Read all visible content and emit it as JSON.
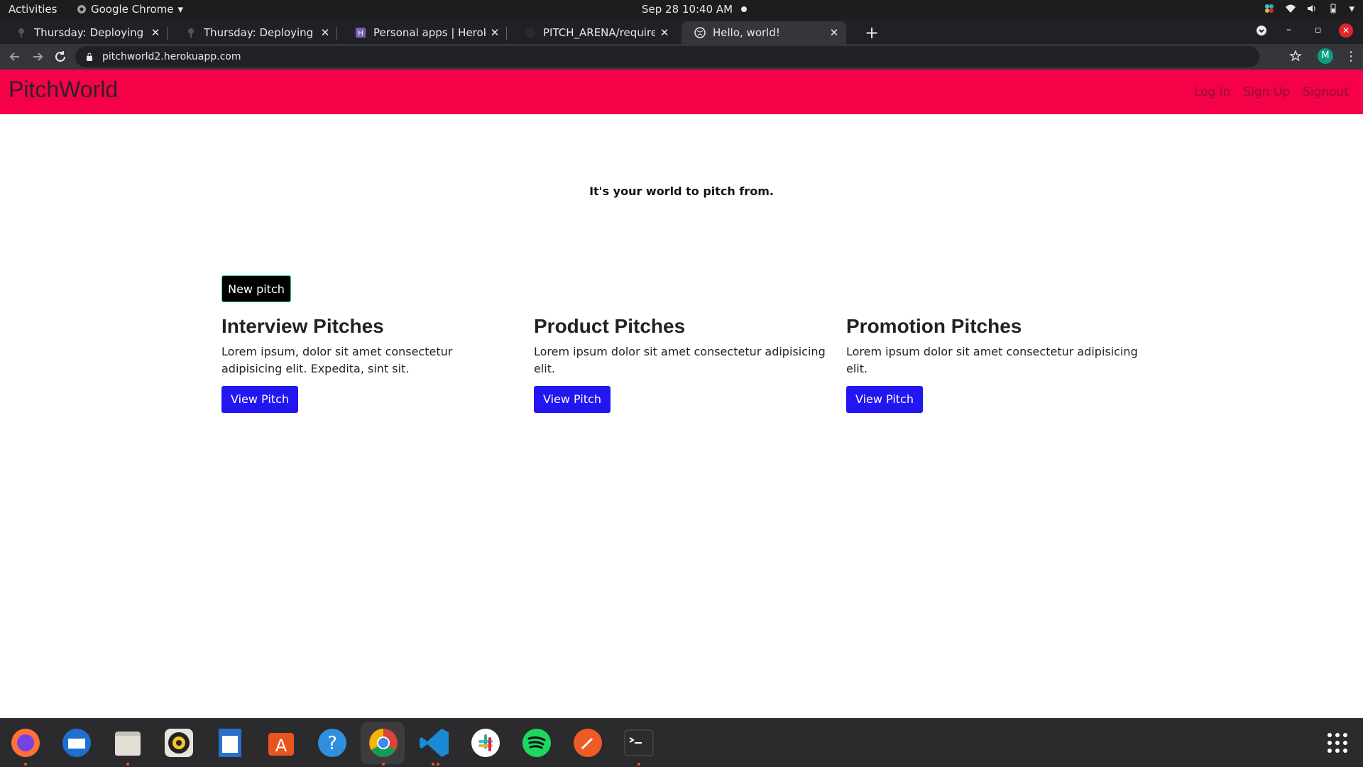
{
  "system": {
    "activities": "Activities",
    "app_name": "Google Chrome",
    "clock": "Sep 28  10:40 AM"
  },
  "tabs": [
    {
      "title": "Thursday: Deploying to H",
      "active": false
    },
    {
      "title": "Thursday: Deploying to H",
      "active": false
    },
    {
      "title": "Personal apps | Heroku",
      "active": false
    },
    {
      "title": "PITCH_ARENA/requireme",
      "active": false
    },
    {
      "title": "Hello, world!",
      "active": true
    }
  ],
  "browser": {
    "url": "pitchworld2.herokuapp.com",
    "profile_initial": "M"
  },
  "site": {
    "brand": "PitchWorld",
    "nav": {
      "login": "Log in",
      "signup": "Sign Up",
      "signout": "Signout"
    },
    "tagline": "It's your world to pitch from.",
    "new_pitch": "New pitch",
    "categories": [
      {
        "title": "Interview Pitches",
        "text": "Lorem ipsum, dolor sit amet consectetur adipisicing elit. Expedita, sint sit.",
        "button": "View Pitch"
      },
      {
        "title": "Product Pitches",
        "text": "Lorem ipsum dolor sit amet consectetur adipisicing elit.",
        "button": "View Pitch"
      },
      {
        "title": "Promotion Pitches",
        "text": "Lorem ipsum dolor sit amet consectetur adipisicing elit.",
        "button": "View Pitch"
      }
    ]
  },
  "colors": {
    "navbar": "#f40148",
    "button_primary": "#2316f0",
    "button_dark": "#000000"
  },
  "dock_icons": [
    "firefox-icon",
    "thunderbird-icon",
    "files-icon",
    "rhythmbox-icon",
    "writer-icon",
    "software-icon",
    "help-icon",
    "chrome-icon",
    "vscode-icon",
    "slack-icon",
    "spotify-icon",
    "postman-icon",
    "terminal-icon"
  ]
}
